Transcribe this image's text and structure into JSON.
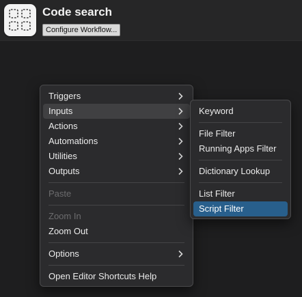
{
  "workflow": {
    "title": "Code search",
    "configure_label": "Configure Workflow..."
  },
  "context_menu": {
    "triggers": "Triggers",
    "inputs": "Inputs",
    "actions": "Actions",
    "automations": "Automations",
    "utilities": "Utilities",
    "outputs": "Outputs",
    "paste": "Paste",
    "zoom_in": "Zoom In",
    "zoom_out": "Zoom Out",
    "options": "Options",
    "shortcuts_help": "Open Editor Shortcuts Help"
  },
  "inputs_submenu": {
    "keyword": "Keyword",
    "file_filter": "File Filter",
    "running_apps_filter": "Running Apps Filter",
    "dictionary_lookup": "Dictionary Lookup",
    "list_filter": "List Filter",
    "script_filter": "Script Filter"
  },
  "icons": {
    "app_icon": "dashed-grid-icon",
    "submenu_arrow": "chevron-right-icon"
  },
  "colors": {
    "canvas": "#1e1e1f",
    "menu_background": "#2b2b2d",
    "hover_highlight": "#404042",
    "selected_highlight": "#285f8c",
    "disabled_text": "#6c6c6e"
  }
}
